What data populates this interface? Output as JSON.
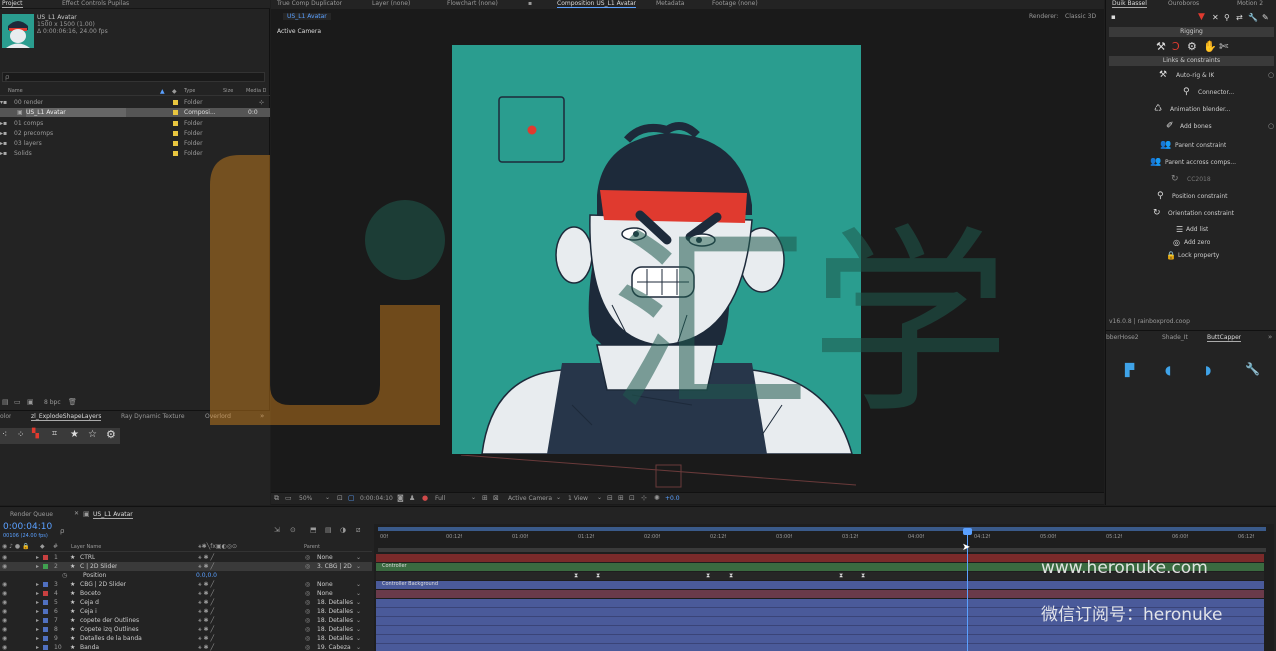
{
  "project_panel": {
    "tabs": [
      "Project",
      "Effect Controls Pupilas"
    ],
    "selected_name": "US_L1 Avatar",
    "selected_dims": "1500 x 1500 (1.00)",
    "selected_duration": "Δ 0:00:06:16, 24.00 fps",
    "search_placeholder": "ρ",
    "columns": [
      "Name",
      "Type",
      "Size",
      "Media D"
    ],
    "items": [
      {
        "name": "00 render",
        "type": "Folder",
        "size": ""
      },
      {
        "name": "US_L1 Avatar",
        "type": "Composi...",
        "size": "0:0"
      },
      {
        "name": "01 comps",
        "type": "Folder",
        "size": ""
      },
      {
        "name": "02 precomps",
        "type": "Folder",
        "size": ""
      },
      {
        "name": "03 layers",
        "type": "Folder",
        "size": ""
      },
      {
        "name": "Solids",
        "type": "Folder",
        "size": ""
      }
    ],
    "bpc": "8 bpc"
  },
  "explode_panel": {
    "tabs": [
      "olor",
      "zl_ExplodeShapeLayers",
      "Ray Dynamic Texture",
      "Overlord"
    ]
  },
  "top_tabs": [
    "True Comp Duplicator",
    "Layer (none)",
    "Flowchart (none)",
    "Composition US_L1 Avatar",
    "Metadata",
    "Footage (none)"
  ],
  "viewer": {
    "comp_subtab": "US_L1 Avatar",
    "renderer_label": "Renderer:",
    "renderer_value": "Classic 3D",
    "active_camera": "Active Camera",
    "zoom": "50%",
    "time": "0:00:04:10",
    "resolution": "Full",
    "camera_select": "Active Camera",
    "view_select": "1 View",
    "exposure": "+0.0"
  },
  "duik": {
    "tabs": [
      "Duik Bassel",
      "Ouroboros",
      "Motion 2"
    ],
    "section_rigging": "Rigging",
    "section_links": "Links & constraints",
    "items": [
      "Auto-rig & IK",
      "Connector...",
      "Animation blender...",
      "Add bones",
      "Parent constraint",
      "Parent accross comps...",
      "CC2018",
      "Position constraint",
      "Orientation constraint",
      "Add list",
      "Add zero",
      "Lock property"
    ],
    "version": "v16.0.8 | rainboxprod.coop"
  },
  "butt_panel": {
    "tabs": [
      "bberHose2",
      "Shade_It",
      "ButtCapper"
    ]
  },
  "timeline": {
    "tabs": [
      "Render Queue",
      "US_L1 Avatar"
    ],
    "current_time": "0:00:04:10",
    "fps_sub": "00106 (24.00 fps)",
    "col_layer_name": "Layer Name",
    "col_parent": "Parent",
    "ruler": [
      "00f",
      "00:12f",
      "01:00f",
      "01:12f",
      "02:00f",
      "02:12f",
      "03:00f",
      "03:12f",
      "04:00f",
      "04:12f",
      "05:00f",
      "05:12f",
      "06:00f",
      "06:12f"
    ],
    "layers": [
      {
        "num": "1",
        "name": "CTRL",
        "parent": "None",
        "color": "#c84040"
      },
      {
        "num": "2",
        "name": "C | 2D Slider",
        "parent": "3. CBG | 2D",
        "color": "#40a050"
      },
      {
        "num": "",
        "name": "Position",
        "parent": "0.0,0.0",
        "color": ""
      },
      {
        "num": "3",
        "name": "CBG | 2D Slider",
        "parent": "None",
        "color": "#5070c0"
      },
      {
        "num": "4",
        "name": "Boceto",
        "parent": "None",
        "color": "#c84040"
      },
      {
        "num": "5",
        "name": "Ceja d",
        "parent": "18. Detalles",
        "color": "#5070c0"
      },
      {
        "num": "6",
        "name": "Ceja i",
        "parent": "18. Detalles",
        "color": "#5070c0"
      },
      {
        "num": "7",
        "name": "copete der Outlines",
        "parent": "18. Detalles",
        "color": "#5070c0"
      },
      {
        "num": "8",
        "name": "Copete izq Outlines",
        "parent": "18. Detalles",
        "color": "#5070c0"
      },
      {
        "num": "9",
        "name": "Detalles de la banda",
        "parent": "18. Detalles",
        "color": "#5070c0"
      },
      {
        "num": "10",
        "name": "Banda",
        "parent": "19. Cabeza",
        "color": "#5070c0"
      }
    ],
    "bar_labels": [
      "Controller",
      "Controller Background"
    ]
  },
  "watermark": {
    "url": "www.heronuke.com",
    "wechat": "微信订阅号：heronuke",
    "logo_chars": "汇学"
  },
  "colors": {
    "comp_bg": "#2a9d8f",
    "headband": "#e03a2f",
    "hair": "#1d2a3a",
    "skin": "#e8ecef",
    "accent": "#5aa0ff",
    "watermark_orange": "#e8901e",
    "watermark_teal": "#1f5a4e"
  }
}
